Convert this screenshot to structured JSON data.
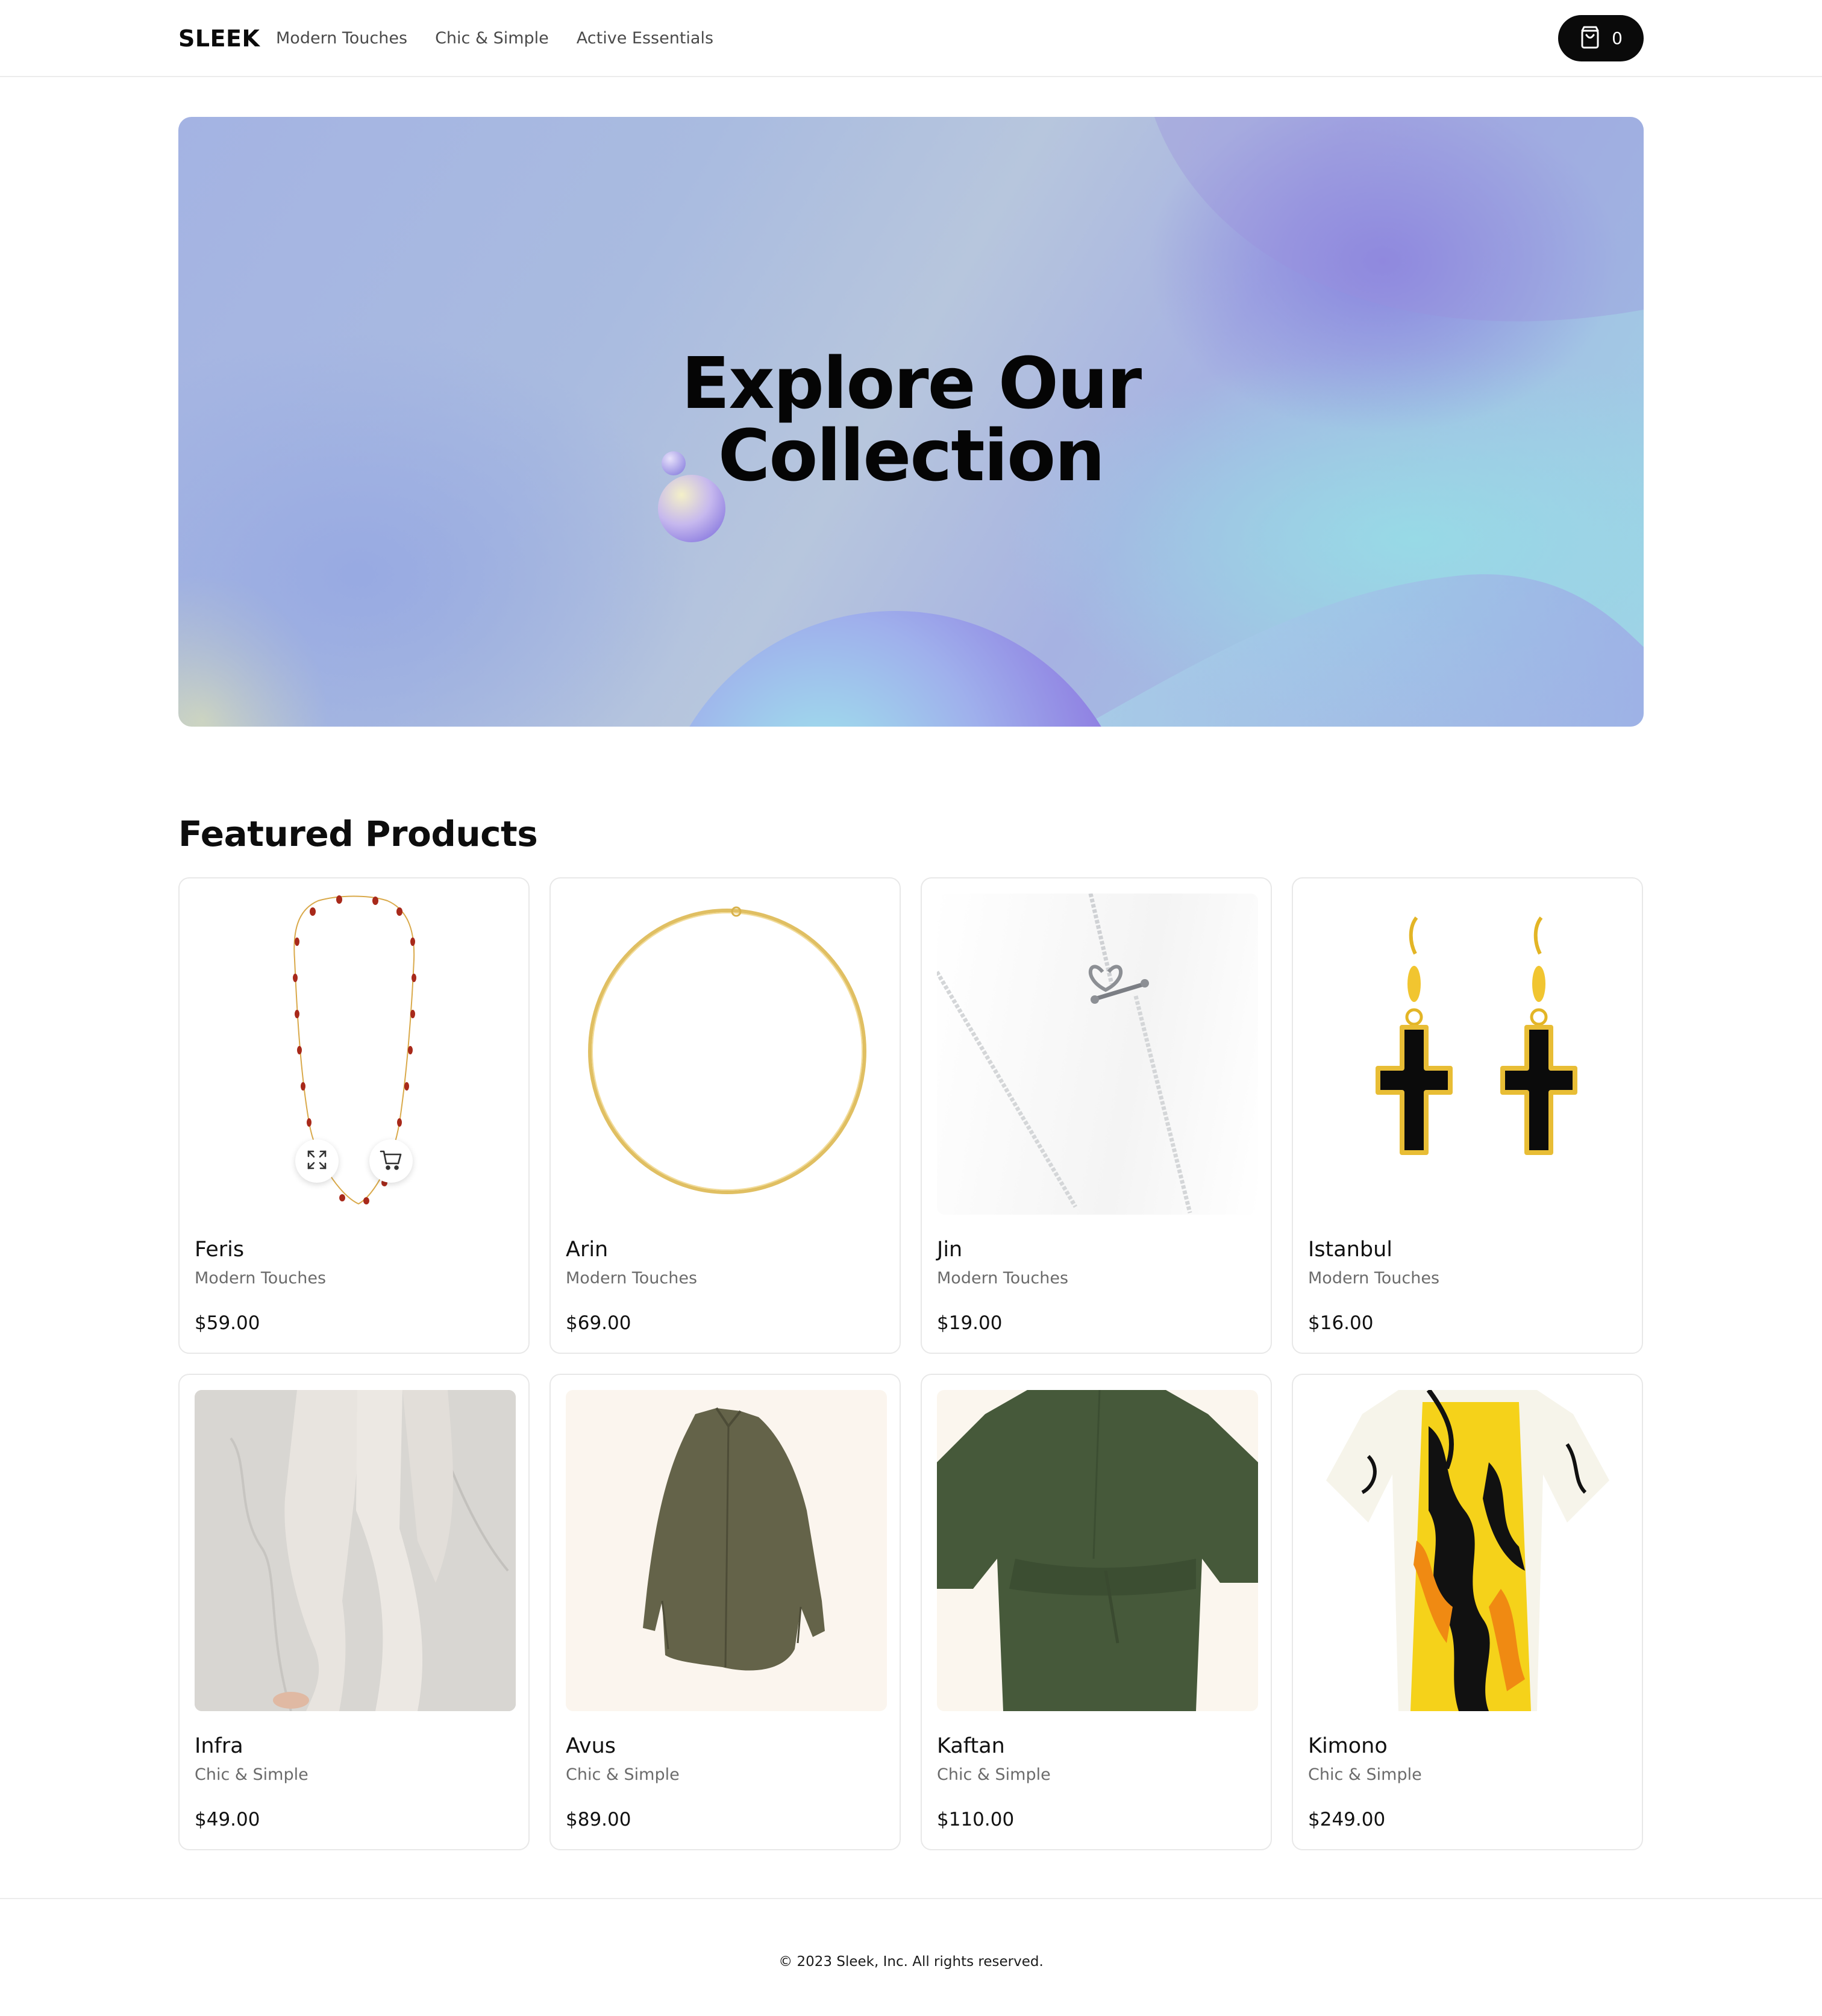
{
  "header": {
    "logo": "SLEEK",
    "nav": [
      "Modern Touches",
      "Chic & Simple",
      "Active Essentials"
    ],
    "cart": {
      "icon": "shopping-bag-icon",
      "count": "0"
    }
  },
  "hero": {
    "title_line1": "Explore Our",
    "title_line2": "Collection"
  },
  "featured": {
    "title": "Featured Products",
    "products": [
      {
        "name": "Feris",
        "category": "Modern Touches",
        "price": "$59.00",
        "image": "red-bead-necklace"
      },
      {
        "name": "Arin",
        "category": "Modern Touches",
        "price": "$69.00",
        "image": "gold-chain-necklace"
      },
      {
        "name": "Jin",
        "category": "Modern Touches",
        "price": "$19.00",
        "image": "silver-heart-chain"
      },
      {
        "name": "Istanbul",
        "category": "Modern Touches",
        "price": "$16.00",
        "image": "cross-earrings"
      },
      {
        "name": "Infra",
        "category": "Chic & Simple",
        "price": "$49.00",
        "image": "linen-pants"
      },
      {
        "name": "Avus",
        "category": "Chic & Simple",
        "price": "$89.00",
        "image": "olive-shirt"
      },
      {
        "name": "Kaftan",
        "category": "Chic & Simple",
        "price": "$110.00",
        "image": "green-kaftan"
      },
      {
        "name": "Kimono",
        "category": "Chic & Simple",
        "price": "$249.00",
        "image": "floral-kimono"
      }
    ],
    "quick_actions": {
      "expand_icon": "expand-icon",
      "add_to_cart_icon": "cart-icon"
    }
  },
  "footer": {
    "copyright": "© 2023 Sleek, Inc. All rights reserved."
  }
}
